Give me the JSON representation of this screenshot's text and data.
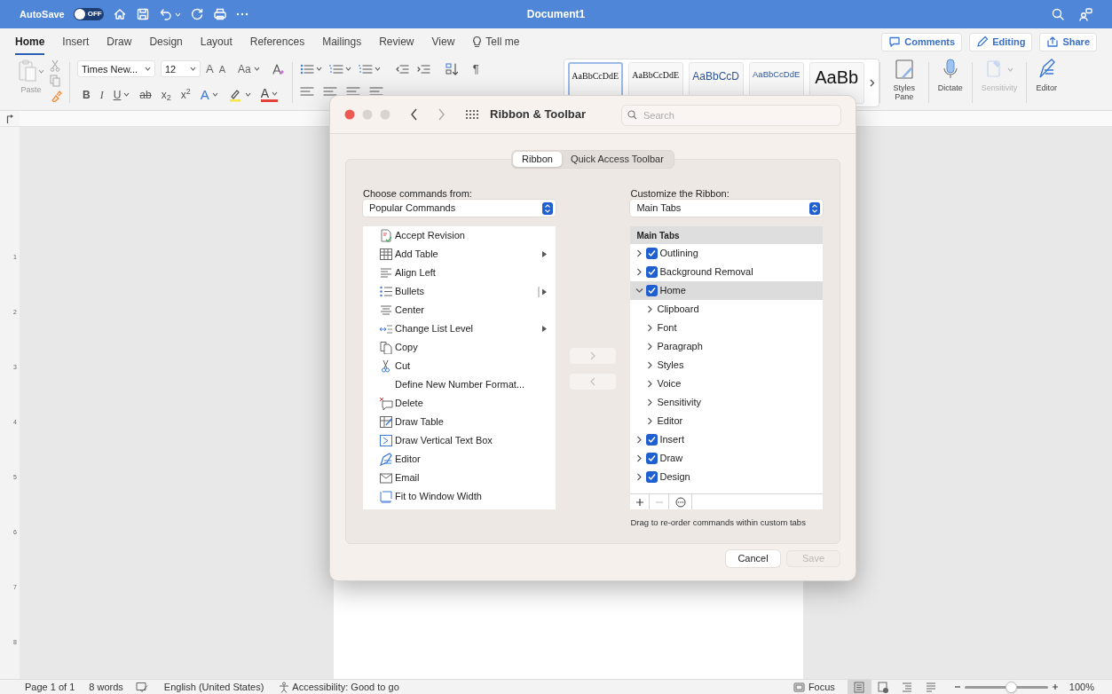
{
  "title_bar": {
    "autosave_label": "AutoSave",
    "autosave_on": false,
    "autosave_state": "OFF",
    "title": "Document1"
  },
  "ribbon_tabs": [
    {
      "label": "Home",
      "selected": true
    },
    {
      "label": "Insert",
      "selected": false
    },
    {
      "label": "Draw",
      "selected": false
    },
    {
      "label": "Design",
      "selected": false
    },
    {
      "label": "Layout",
      "selected": false
    },
    {
      "label": "References",
      "selected": false
    },
    {
      "label": "Mailings",
      "selected": false
    },
    {
      "label": "Review",
      "selected": false
    },
    {
      "label": "View",
      "selected": false
    }
  ],
  "tell_me": "Tell me",
  "top_buttons": [
    "Comments",
    "Editing",
    "Share"
  ],
  "ribbon": {
    "paste_label": "Paste",
    "font_name": "Times New...",
    "font_size": "12",
    "font_row1": [
      {
        "kind": "grow",
        "label": "A"
      },
      {
        "kind": "shrink",
        "label": "A"
      },
      {
        "kind": "case",
        "label": "Aa"
      }
    ],
    "font_row2": [
      {
        "kind": "bold",
        "label": "B"
      },
      {
        "kind": "italic",
        "label": "I"
      },
      {
        "kind": "underline",
        "label": "U"
      },
      {
        "kind": "strike",
        "label": "ab"
      },
      {
        "kind": "sub",
        "label": "x$_{2}$"
      },
      {
        "kind": "sup",
        "label": "x$^{2}$"
      },
      {
        "kind": "effects",
        "label": "A"
      },
      {
        "kind": "color",
        "label": "A"
      }
    ],
    "pilcrow": "¶",
    "styles": [
      {
        "kind": "serif",
        "preview": "AaBbCcDdE",
        "selected": true
      },
      {
        "kind": "serif",
        "preview": "AaBbCcDdE",
        "selected": false
      },
      {
        "kind": "heading",
        "preview": "AaBbCcD",
        "selected": false
      },
      {
        "kind": "heading2",
        "preview": "AaBbCcDdE",
        "selected": false
      },
      {
        "kind": "title",
        "preview": "AaBb",
        "selected": false
      }
    ],
    "tools": [
      {
        "label": "Styles Pane",
        "disabled": false
      },
      {
        "label": "Dictate",
        "disabled": false
      },
      {
        "label": "Sensitivity",
        "disabled": true
      },
      {
        "label": "Editor",
        "disabled": false
      }
    ]
  },
  "ruler_numbers": [
    "1",
    "2",
    "3",
    "4",
    "5",
    "6",
    "7",
    "8"
  ],
  "dialog": {
    "title": "Ribbon & Toolbar",
    "search_placeholder": "Search",
    "segments": [
      {
        "label": "Ribbon",
        "selected": true
      },
      {
        "label": "Quick Access Toolbar",
        "selected": false
      }
    ],
    "left": {
      "label": "Choose commands from:",
      "popup": "Popular Commands",
      "commands": [
        {
          "label": "Accept Revision"
        },
        {
          "label": "Add Table",
          "submenu": true
        },
        {
          "label": "Align Left"
        },
        {
          "label": "Bullets",
          "submenu": true,
          "split": true
        },
        {
          "label": "Center"
        },
        {
          "label": "Change List Level",
          "submenu": true
        },
        {
          "label": "Copy"
        },
        {
          "label": "Cut"
        },
        {
          "label": "Define New Number Format..."
        },
        {
          "label": "Delete"
        },
        {
          "label": "Draw Table"
        },
        {
          "label": "Draw Vertical Text Box"
        },
        {
          "label": "Editor"
        },
        {
          "label": "Email"
        },
        {
          "label": "Fit to Window Width"
        }
      ]
    },
    "move_buttons": [
      {
        "kind": "add",
        "disabled": true
      },
      {
        "kind": "remove",
        "disabled": true
      }
    ],
    "right": {
      "label": "Customize the Ribbon:",
      "popup": "Main Tabs",
      "header": "Main Tabs",
      "tree": [
        {
          "label": "Outlining",
          "checked": true,
          "expanded": false,
          "selected": false
        },
        {
          "label": "Background Removal",
          "checked": true,
          "expanded": false,
          "selected": false
        },
        {
          "label": "Home",
          "checked": true,
          "expanded": true,
          "selected": true,
          "children": [
            {
              "label": "Clipboard",
              "expanded": false,
              "selected": false
            },
            {
              "label": "Font",
              "expanded": false,
              "selected": false
            },
            {
              "label": "Paragraph",
              "expanded": false,
              "selected": false
            },
            {
              "label": "Styles",
              "expanded": false,
              "selected": false
            },
            {
              "label": "Voice",
              "expanded": false,
              "selected": false
            },
            {
              "label": "Sensitivity",
              "expanded": false,
              "selected": false
            },
            {
              "label": "Editor",
              "expanded": false,
              "selected": false
            }
          ]
        },
        {
          "label": "Insert",
          "checked": true,
          "expanded": false,
          "selected": false
        },
        {
          "label": "Draw",
          "checked": true,
          "expanded": false,
          "selected": false
        },
        {
          "label": "Design",
          "checked": true,
          "expanded": false,
          "selected": false
        }
      ],
      "tools": [
        {
          "kind": "plus",
          "disabled": false
        },
        {
          "kind": "minus",
          "disabled": true
        },
        {
          "kind": "more",
          "disabled": false
        }
      ]
    },
    "hint": "Drag to re-order commands within custom tabs",
    "buttons": [
      {
        "label": "Cancel",
        "disabled": false
      },
      {
        "label": "Save",
        "disabled": true
      }
    ]
  },
  "status_bar": {
    "page": "Page 1 of 1",
    "words": "8 words",
    "language": "English (United States)",
    "accessibility": "Accessibility: Good to go",
    "focus": "Focus",
    "views": [
      {
        "kind": "print",
        "selected": true
      },
      {
        "kind": "web",
        "selected": false
      },
      {
        "kind": "outline",
        "selected": false
      },
      {
        "kind": "draft",
        "selected": false
      }
    ],
    "zoom_slider": {
      "level": 0.55
    },
    "zoom": "100%"
  }
}
